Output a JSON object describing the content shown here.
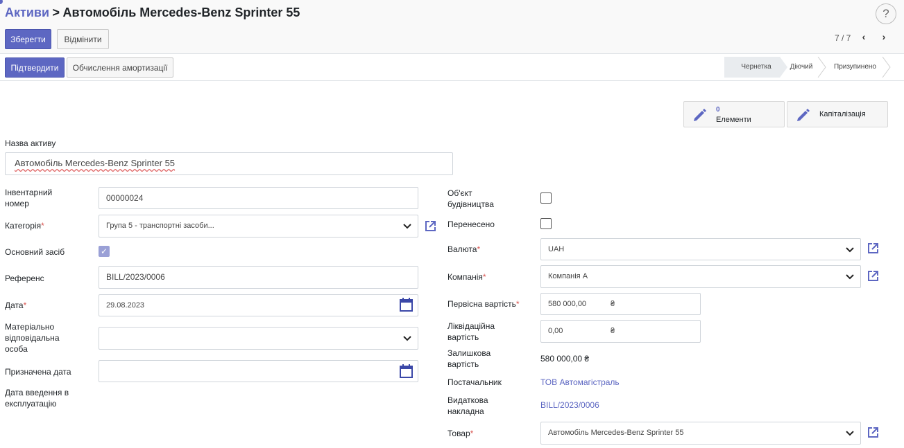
{
  "breadcrumb": {
    "root": "Активи",
    "separator": ">",
    "current": "Автомобіль Mercedes-Benz Sprinter 55"
  },
  "help_label": "?",
  "toolbar": {
    "save_label": "Зберегти",
    "discard_label": "Відмінити"
  },
  "pager": {
    "value": "7 / 7",
    "prev": "‹",
    "next": "›"
  },
  "actions": {
    "confirm_label": "Підтвердити",
    "compute_label": "Обчислення амортизації"
  },
  "stages": [
    "Чернетка",
    "Діючий",
    "Призупинено"
  ],
  "active_stage": "Чернетка",
  "smart_buttons": {
    "items_count": "0",
    "items_label": "Елементи",
    "capitalization_label": "Капіталізація"
  },
  "form": {
    "name_label": "Назва активу",
    "name_value": "Автомобіль Mercedes-Benz Sprinter 55",
    "left": {
      "inventory_label_1": "Інвентарний",
      "inventory_label_2": "номер",
      "inventory_value": "00000024",
      "category_label": "Категорія",
      "category_value": "Група 5 - транспортні засоби...",
      "fixed_asset_label": "Основний засіб",
      "fixed_asset_checked": true,
      "reference_label": "Референс",
      "reference_value": "BILL/2023/0006",
      "date_label": "Дата",
      "date_value": "29.08.2023",
      "responsible_label_1": "Матеріально",
      "responsible_label_2": "відповідальна",
      "responsible_label_3": "особа",
      "responsible_value": "",
      "assigned_date_label": "Призначена дата",
      "assigned_date_value": "",
      "commission_date_label_1": "Дата введення в",
      "commission_date_label_2": "експлуатацію"
    },
    "right": {
      "construction_label_1": "Об'єкт",
      "construction_label_2": "будівництва",
      "construction_checked": false,
      "transferred_label": "Перенесено",
      "transferred_checked": false,
      "currency_label": "Валюта",
      "currency_value": "UAH",
      "company_label": "Компанія",
      "company_value": "Компанія А",
      "initial_value_label": "Первісна вартість",
      "initial_value": "580 000,00",
      "currency_symbol": "₴",
      "salvage_label_1": "Ліквідаційна",
      "salvage_label_2": "вартість",
      "salvage_value": "0,00",
      "residual_label_1": "Залишкова",
      "residual_label_2": "вартість",
      "residual_value": "580 000,00 ₴",
      "vendor_label": "Постачальник",
      "vendor_value": "ТОВ Автомагістраль",
      "invoice_label_1": "Видаткова",
      "invoice_label_2": "накладна",
      "invoice_value": "BILL/2023/0006",
      "product_label": "Товар",
      "product_value": "Автомобіль Mercedes-Benz Sprinter 55"
    }
  },
  "colors": {
    "accent": "#5d67c2",
    "required": "#d9534f",
    "border": "#cfd4da"
  },
  "icons": [
    "help-icon",
    "chevron-left-icon",
    "chevron-right-icon",
    "chevron-down-icon",
    "external-link-icon",
    "calendar-icon",
    "pencil-icon",
    "checkbox-icon"
  ]
}
